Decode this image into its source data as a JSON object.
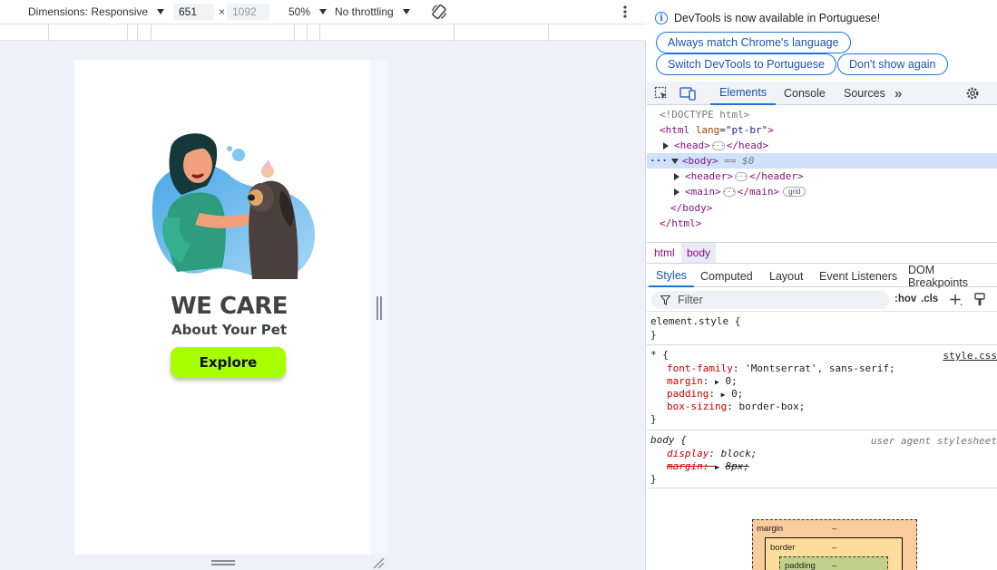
{
  "device_toolbar": {
    "dimensions_label": "Dimensions: Responsive",
    "width_value": "651",
    "times_sign": "×",
    "height_placeholder": "1092",
    "zoom": "50%",
    "throttling": "No throttling"
  },
  "page": {
    "title": "WE CARE",
    "subtitle": "About Your Pet",
    "cta_label": "Explore",
    "accent_color": "#a8ff00"
  },
  "devtools": {
    "banner": {
      "message": "DevTools is now available in Portuguese!",
      "btn_match": "Always match Chrome's language",
      "btn_switch": "Switch DevTools to Portuguese",
      "btn_dismiss": "Don't show again"
    },
    "tabs": [
      "Elements",
      "Console",
      "Sources"
    ],
    "dom": {
      "doctype": "<!DOCTYPE html>",
      "html_open_tag": "<html",
      "html_lang_attr": "lang",
      "html_lang_value": "\"pt-br\"",
      "html_close_bracket": ">",
      "head_open": "<head>",
      "head_close": "</head>",
      "body_open": "<body>",
      "body_selected_marker": "== $0",
      "header_open": "<header>",
      "header_close": "</header>",
      "main_open": "<main>",
      "main_close": "</main>",
      "main_badge": "grid",
      "body_close": "</body>",
      "html_close": "</html>"
    },
    "breadcrumbs": [
      "html",
      "body"
    ],
    "style_tabs": [
      "Styles",
      "Computed",
      "Layout",
      "Event Listeners",
      "DOM Breakpoints"
    ],
    "filter_placeholder": "Filter",
    "hov": ":hov",
    "cls": ".cls",
    "styles": {
      "element_style_selector": "element.style {",
      "close_brace": "}",
      "universal_selector": "* {",
      "universal_source": "style.css",
      "font_family_prop": "font-family",
      "font_family_val": "'Montserrat', sans-serif;",
      "margin_prop": "margin",
      "margin_val": "0;",
      "padding_prop": "padding",
      "padding_val": "0;",
      "box_sizing_prop": "box-sizing",
      "box_sizing_val": "border-box;",
      "body_selector": "body {",
      "ua_label": "user agent stylesheet",
      "display_prop": "display",
      "display_val": "block;",
      "ua_margin_prop": "margin",
      "ua_margin_val": "8px;"
    },
    "box_model": {
      "margin_label": "margin",
      "border_label": "border",
      "padding_label": "padding",
      "dash": "–"
    }
  }
}
